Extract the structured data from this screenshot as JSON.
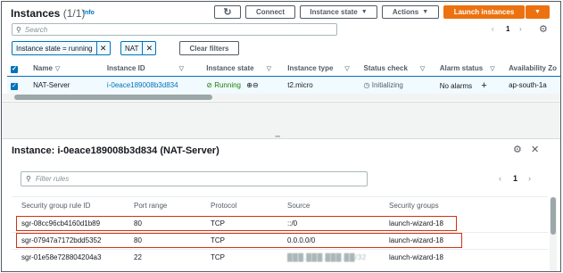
{
  "header": {
    "title": "Instances",
    "count": "(1/1)",
    "info": "Info",
    "refresh_icon": "refresh-icon",
    "connect_label": "Connect",
    "instance_state_label": "Instance state",
    "actions_label": "Actions",
    "launch_label": "Launch instances"
  },
  "search": {
    "placeholder": "Search"
  },
  "pager": {
    "page": "1"
  },
  "filters": {
    "chip1": "Instance state = running",
    "chip2": "NAT",
    "clear_label": "Clear filters"
  },
  "table": {
    "columns": [
      "Name",
      "Instance ID",
      "Instance state",
      "Instance type",
      "Status check",
      "Alarm status",
      "Availability Zo"
    ],
    "row": {
      "name": "NAT-Server",
      "id": "i-0eace189008b3d834",
      "state": "Running",
      "type": "t2.micro",
      "status": "Initializing",
      "alarm": "No alarms",
      "az": "ap-south-1a"
    }
  },
  "detail": {
    "title": "Instance: i-0eace189008b3d834 (NAT-Server)",
    "filter_placeholder": "Filter rules",
    "page": "1",
    "columns": [
      "Security group rule ID",
      "Port range",
      "Protocol",
      "Source",
      "Security groups"
    ],
    "rules": [
      {
        "id": "sgr-08cc96cb4160d1b89",
        "port": "80",
        "protocol": "TCP",
        "source": "::/0",
        "group": "launch-wizard-18"
      },
      {
        "id": "sgr-07947a7172bdd5352",
        "port": "80",
        "protocol": "TCP",
        "source": "0.0.0.0/0",
        "group": "launch-wizard-18"
      },
      {
        "id": "sgr-01e58e728804204a3",
        "port": "22",
        "protocol": "TCP",
        "source": "███.███.███.██/32",
        "group": "launch-wizard-18"
      }
    ]
  },
  "colors": {
    "accent": "#0073bb",
    "orange": "#ec7211",
    "highlight": "#d13212",
    "running": "#1d8102"
  }
}
